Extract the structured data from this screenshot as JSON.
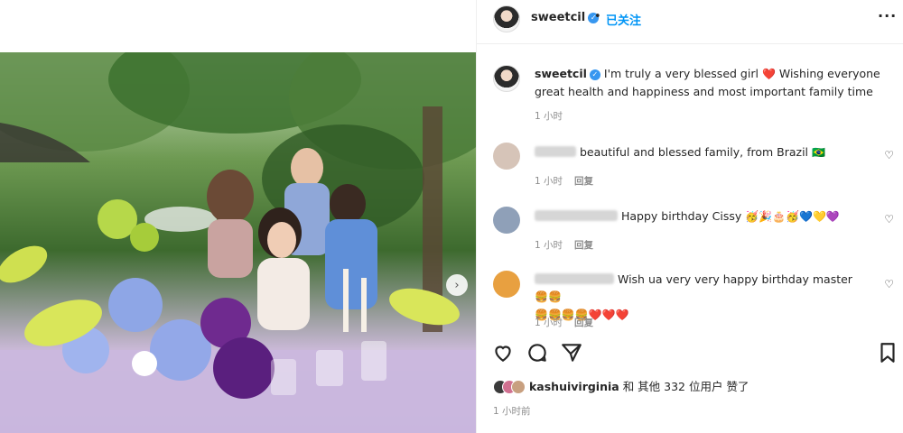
{
  "post": {
    "username": "sweetcil",
    "separator": "•",
    "follow_status": "已关注",
    "more_icon": "more-horizontal-icon",
    "caption_text": "I'm truly a very blessed girl",
    "caption_emoji": "❤️",
    "caption_text_2": "Wishing everyone great health and happiness and most important family time",
    "caption_time": "1 小时"
  },
  "comments": [
    {
      "text": "beautiful and blessed family, from Brazil",
      "flag": "🇧🇷",
      "time": "1 小时",
      "reply": "回复"
    },
    {
      "text": "Happy birthday Cissy",
      "emojis": "🥳🎉🎂🥳💙💛💜",
      "time": "1 小时",
      "reply": "回复"
    },
    {
      "text": "Wish ua very very happy birthday master",
      "emojis": "🍔🍔",
      "emojis_2": "🍔🍔🍔🍔❤️❤️❤️",
      "time": "1 小时",
      "reply": "回复"
    }
  ],
  "likes": {
    "liker": "kashuivirginia",
    "text": "和 其他 332 位用户 赞了"
  },
  "bottom_time": "1 小时前",
  "colors": {
    "accent": "#0095f6",
    "verified": "#3797f0",
    "muted": "#8e8e8e"
  }
}
